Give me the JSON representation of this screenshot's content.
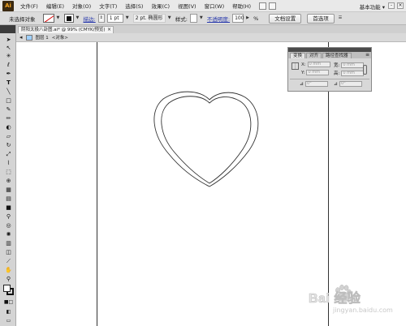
{
  "app": {
    "logo": "Ai"
  },
  "menubar": {
    "items": [
      "文件(F)",
      "编辑(E)",
      "对象(O)",
      "文字(T)",
      "选择(S)",
      "效果(C)",
      "视图(V)",
      "窗口(W)",
      "帮助(H)"
    ],
    "workspace": "基本功能"
  },
  "controlbar": {
    "selection_status": "未选择对象",
    "stroke_label": "描边:",
    "stroke_weight": "1 pt",
    "brush_profile": "2 pt. 椭圆形",
    "style_label": "样式:",
    "opacity_label": "不透明度:",
    "opacity_value": "100",
    "opacity_unit": "%",
    "doc_setup_button": "文档设置",
    "preferences_button": "首选项"
  },
  "document": {
    "tab_title": "阴阳太极八卦图.ai* @ 99% (CMYK/预览)",
    "tab_close": "×",
    "layer": "图层 1",
    "object": "<对象>"
  },
  "transform_panel": {
    "tabs": [
      "变换",
      "对齐",
      "路径查找器"
    ],
    "active_tab": "变换",
    "menu_glyph": "≡",
    "x_label": "X:",
    "y_label": "Y:",
    "w_label": "宽:",
    "h_label": "高:",
    "x_value": "0 mm",
    "y_value": "0 mm",
    "w_value": "0 mm",
    "h_value": "0 mm",
    "angle_symbol": "⊿",
    "rotate_value": "0°",
    "shear_value": "0°"
  },
  "watermark": {
    "brand": "Bai  经验",
    "sub": "jingyan.baidu.com"
  },
  "colors": {
    "menubar_bg": "#e9e9e9",
    "toolbar_bg": "#dcdcdc",
    "panel_bg": "#d8d8d8",
    "logo_bg": "#3b2a12",
    "logo_fg": "#f5a623"
  },
  "icons": {
    "tools": [
      "selection-arrow",
      "direct-selection-arrow",
      "magic-wand",
      "lasso",
      "pen",
      "type",
      "line-segment",
      "rectangle",
      "paintbrush",
      "pencil",
      "blob-brush",
      "eraser",
      "rotate",
      "scale",
      "width",
      "free-transform",
      "shape-builder",
      "perspective-grid",
      "mesh",
      "gradient",
      "eyedropper",
      "blend",
      "symbol-sprayer",
      "column-graph",
      "artboard",
      "slice",
      "hand",
      "zoom"
    ]
  }
}
